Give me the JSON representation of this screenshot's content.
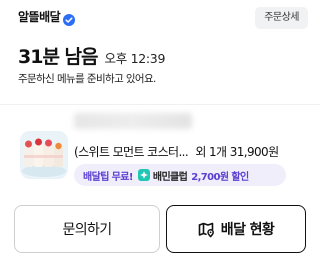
{
  "header": {
    "store_name": "알뜰배달",
    "verified_icon": "verified-badge-icon",
    "detail_label": "주문상세"
  },
  "eta": {
    "minutes_left": "31분 남음",
    "arrival_time": "오후 12:39"
  },
  "status_message": "주문하신 메뉴를 준비하고 있어요.",
  "order": {
    "store_name_blurred": "",
    "thumbnail_icon": "food-thumbnail",
    "item_name": "(스위트 모먼트 코스터...",
    "extra_items": "외 1개",
    "total_price": "31,900원"
  },
  "benefits": {
    "free_tip": "배달팁 무료!",
    "club_icon": "baemin-club-icon",
    "club_label": "배민클럽",
    "club_discount": "2,700원 할인"
  },
  "actions": {
    "inquiry_label": "문의하기",
    "tracking_label": "배달 현황",
    "tracking_icon": "map-icon"
  },
  "colors": {
    "accent_purple": "#5a3fd0",
    "badge_bg": "#f1eefc",
    "verified_blue": "#2b6ef5"
  }
}
